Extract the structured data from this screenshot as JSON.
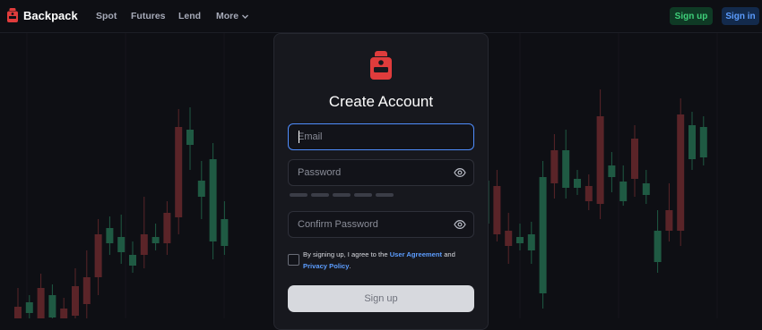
{
  "header": {
    "brand": "Backpack",
    "nav": {
      "spot": "Spot",
      "futures": "Futures",
      "lend": "Lend",
      "more": "More"
    },
    "signup_label": "Sign up",
    "signin_label": "Sign in"
  },
  "form": {
    "title": "Create Account",
    "email": {
      "placeholder": "Email",
      "value": ""
    },
    "password": {
      "placeholder": "Password",
      "value": ""
    },
    "confirm": {
      "placeholder": "Confirm Password",
      "value": ""
    },
    "terms": {
      "prefix": "By signing up, I agree to the ",
      "agreement_link": "User Agreement",
      "middle": " and ",
      "privacy_link": "Privacy Policy",
      "suffix": ".",
      "checked": false
    },
    "submit_label": "Sign up"
  },
  "colors": {
    "brand": "#e03c3c",
    "accent_blue": "#4f8dfd",
    "signup_green": "#3fd07a",
    "candle_up": "#1f5a43",
    "candle_down": "#5a2428"
  },
  "icons": [
    "backpack-logo-icon",
    "chevron-down-icon",
    "eye-icon"
  ],
  "background_candles": [
    {
      "c": "d",
      "o": 343,
      "c2": 356,
      "h": 322,
      "l": 356
    },
    {
      "c": "u",
      "o": 350,
      "c2": 338,
      "h": 330,
      "l": 356
    },
    {
      "c": "d",
      "o": 322,
      "c2": 356,
      "h": 306,
      "l": 356
    },
    {
      "c": "u",
      "o": 355,
      "c2": 330,
      "h": 318,
      "l": 356
    },
    {
      "c": "d",
      "o": 345,
      "c2": 356,
      "h": 333,
      "l": 356
    },
    {
      "c": "d",
      "o": 320,
      "c2": 353,
      "h": 300,
      "l": 356
    },
    {
      "c": "d",
      "o": 310,
      "c2": 340,
      "h": 280,
      "l": 356
    },
    {
      "c": "d",
      "o": 262,
      "c2": 310,
      "h": 245,
      "l": 330
    },
    {
      "c": "u",
      "o": 272,
      "c2": 255,
      "h": 242,
      "l": 285
    },
    {
      "c": "u",
      "o": 282,
      "c2": 265,
      "h": 240,
      "l": 295
    },
    {
      "c": "u",
      "o": 297,
      "c2": 285,
      "h": 270,
      "l": 305
    },
    {
      "c": "d",
      "o": 262,
      "c2": 285,
      "h": 220,
      "l": 300
    },
    {
      "c": "u",
      "o": 272,
      "c2": 265,
      "h": 250,
      "l": 280
    },
    {
      "c": "d",
      "o": 238,
      "c2": 272,
      "h": 225,
      "l": 285
    },
    {
      "c": "d",
      "o": 142,
      "c2": 243,
      "h": 122,
      "l": 262
    },
    {
      "c": "u",
      "o": 162,
      "c2": 145,
      "h": 120,
      "l": 190
    },
    {
      "c": "u",
      "o": 220,
      "c2": 202,
      "h": 180,
      "l": 245
    },
    {
      "c": "u",
      "o": 270,
      "c2": 178,
      "h": 160,
      "l": 290
    },
    {
      "c": "u",
      "o": 275,
      "c2": 245,
      "h": 225,
      "l": 285
    },
    {
      "c": "d",
      "o": 215,
      "c2": 250,
      "h": 195,
      "l": 262
    },
    {
      "c": "u",
      "o": 240,
      "c2": 180,
      "h": 160,
      "l": 258
    },
    {
      "c": "d",
      "o": 185,
      "c2": 200,
      "h": 170,
      "l": 220
    },
    {
      "c": "u",
      "o": 250,
      "c2": 202,
      "h": 182,
      "l": 262
    },
    {
      "c": "d",
      "o": 208,
      "c2": 262,
      "h": 190,
      "l": 270
    },
    {
      "c": "d",
      "o": 258,
      "c2": 275,
      "h": 238,
      "l": 295
    },
    {
      "c": "u",
      "o": 272,
      "c2": 265,
      "h": 250,
      "l": 280
    },
    {
      "c": "u",
      "o": 280,
      "c2": 262,
      "h": 248,
      "l": 295
    },
    {
      "c": "u",
      "o": 328,
      "c2": 198,
      "h": 180,
      "l": 345
    },
    {
      "c": "d",
      "o": 168,
      "c2": 205,
      "h": 150,
      "l": 222
    },
    {
      "c": "u",
      "o": 210,
      "c2": 168,
      "h": 145,
      "l": 222
    },
    {
      "c": "u",
      "o": 210,
      "c2": 200,
      "h": 190,
      "l": 218
    },
    {
      "c": "d",
      "o": 208,
      "c2": 225,
      "h": 195,
      "l": 235
    },
    {
      "c": "d",
      "o": 130,
      "c2": 228,
      "h": 100,
      "l": 245
    },
    {
      "c": "u",
      "o": 198,
      "c2": 185,
      "h": 170,
      "l": 215
    },
    {
      "c": "u",
      "o": 225,
      "c2": 203,
      "h": 185,
      "l": 230
    },
    {
      "c": "d",
      "o": 155,
      "c2": 200,
      "h": 140,
      "l": 220
    },
    {
      "c": "u",
      "o": 218,
      "c2": 205,
      "h": 190,
      "l": 228
    },
    {
      "c": "u",
      "o": 293,
      "c2": 258,
      "h": 235,
      "l": 305
    },
    {
      "c": "d",
      "o": 235,
      "c2": 258,
      "h": 205,
      "l": 270
    },
    {
      "c": "d",
      "o": 128,
      "c2": 258,
      "h": 110,
      "l": 275
    },
    {
      "c": "u",
      "o": 178,
      "c2": 140,
      "h": 125,
      "l": 190
    },
    {
      "c": "u",
      "o": 176,
      "c2": 142,
      "h": 130,
      "l": 185
    }
  ]
}
